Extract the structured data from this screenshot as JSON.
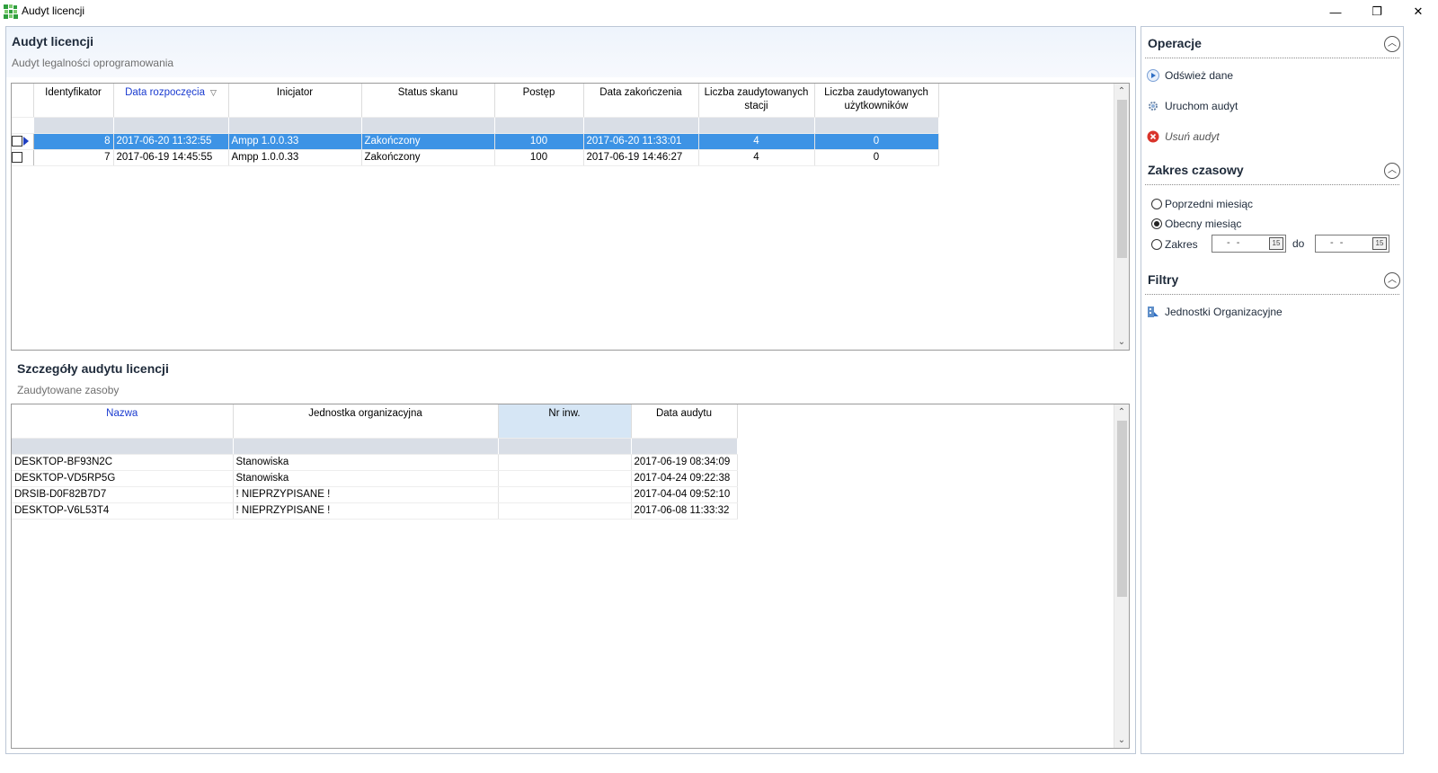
{
  "window": {
    "title": "Audyt licencji",
    "min_glyph": "—",
    "max_glyph": "❐",
    "close_glyph": "✕"
  },
  "audit_section": {
    "title": "Audyt licencji",
    "subtitle": "Audyt legalności oprogramowania",
    "columns": [
      "Identyfikator",
      "Data rozpoczęcia",
      "Inicjator",
      "Status skanu",
      "Postęp",
      "Data zakończenia",
      "Liczba zaudytowanych stacji",
      "Liczba zaudytowanych użytkowników"
    ],
    "rows": [
      {
        "id": "8",
        "start": "2017-06-20 11:32:55",
        "initiator": "Ampp 1.0.0.33",
        "status": "Zakończony",
        "progress": "100",
        "end": "2017-06-20 11:33:01",
        "stations": "4",
        "users": "0"
      },
      {
        "id": "7",
        "start": "2017-06-19 14:45:55",
        "initiator": "Ampp 1.0.0.33",
        "status": "Zakończony",
        "progress": "100",
        "end": "2017-06-19 14:46:27",
        "stations": "4",
        "users": "0"
      }
    ]
  },
  "details_section": {
    "title": "Szczegóły audytu licencji",
    "subtitle": "Zaudytowane zasoby",
    "columns": [
      "Nazwa",
      "Jednostka organizacyjna",
      "Nr inw.",
      "Data audytu"
    ],
    "rows": [
      {
        "name": "DESKTOP-BF93N2C",
        "unit": "Stanowiska",
        "inv": "",
        "date": "2017-06-19 08:34:09"
      },
      {
        "name": "DESKTOP-VD5RP5G",
        "unit": "Stanowiska",
        "inv": "",
        "date": "2017-04-24 09:22:38"
      },
      {
        "name": "DRSIB-D0F82B7D7",
        "unit": "! NIEPRZYPISANE !",
        "inv": "",
        "date": "2017-04-04 09:52:10"
      },
      {
        "name": "DESKTOP-V6L53T4",
        "unit": "! NIEPRZYPISANE !",
        "inv": "",
        "date": "2017-06-08 11:33:32"
      }
    ]
  },
  "sidebar": {
    "operations": {
      "title": "Operacje",
      "refresh": "Odśwież dane",
      "run": "Uruchom audyt",
      "delete": "Usuń audyt"
    },
    "time_range": {
      "title": "Zakres czasowy",
      "prev_month": "Poprzedni miesiąc",
      "this_month": "Obecny miesiąc",
      "range": "Zakres",
      "from_value": "- -",
      "to_label": "do",
      "to_value": "- -",
      "selected": "this_month"
    },
    "filters": {
      "title": "Filtry",
      "org_units": "Jednostki Organizacyjne"
    }
  },
  "colors": {
    "selected_row": "#3d93e5",
    "sorted_header": "#1a3bd0",
    "delete_icon": "#d9342b",
    "play_icon": "#2f6fc4"
  }
}
